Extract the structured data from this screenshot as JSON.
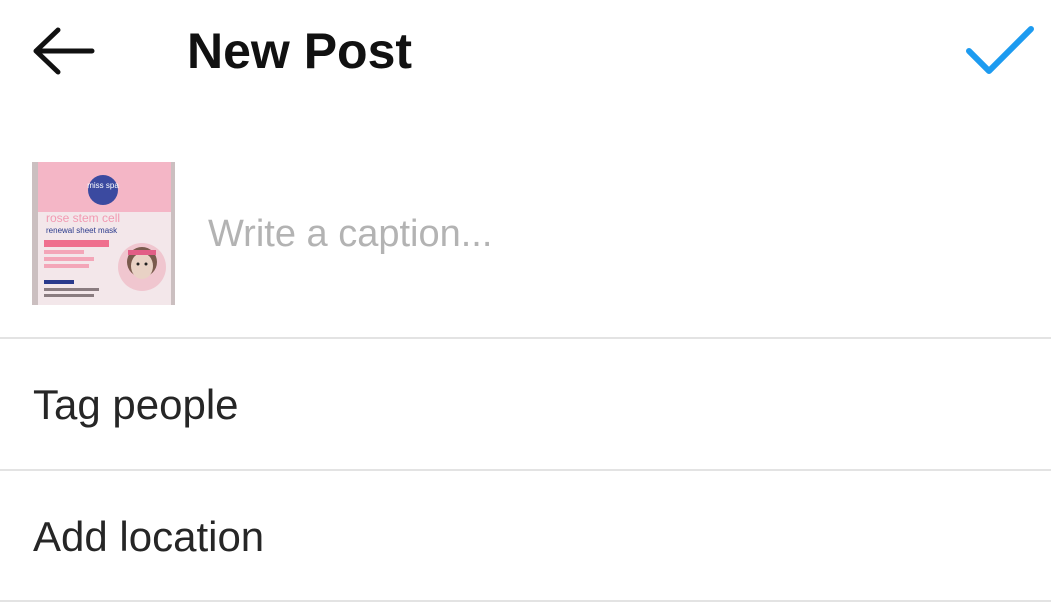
{
  "header": {
    "title": "New Post",
    "back_icon": "arrow-left-icon",
    "confirm_icon": "checkmark-icon",
    "confirm_color": "#1d9bf0"
  },
  "caption": {
    "placeholder": "Write a caption...",
    "value": ""
  },
  "thumbnail": {
    "brand_text": "miss spa",
    "product_line1": "rose stem cell",
    "product_line2": "renewal sheet mask"
  },
  "options": [
    {
      "label": "Tag people"
    },
    {
      "label": "Add location"
    }
  ]
}
